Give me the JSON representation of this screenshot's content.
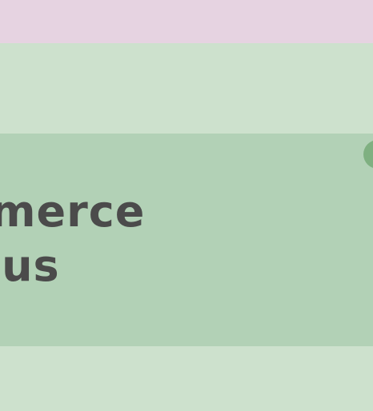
{
  "banner": {
    "heading_line1": "mmerce",
    "heading_line2": "ocus"
  },
  "colors": {
    "top_band": "#e6d3e1",
    "page_background": "#cde1cd",
    "card_background": "#b2d1b6",
    "accent_dot": "#7fb081",
    "heading_text": "#4b4b4b"
  }
}
